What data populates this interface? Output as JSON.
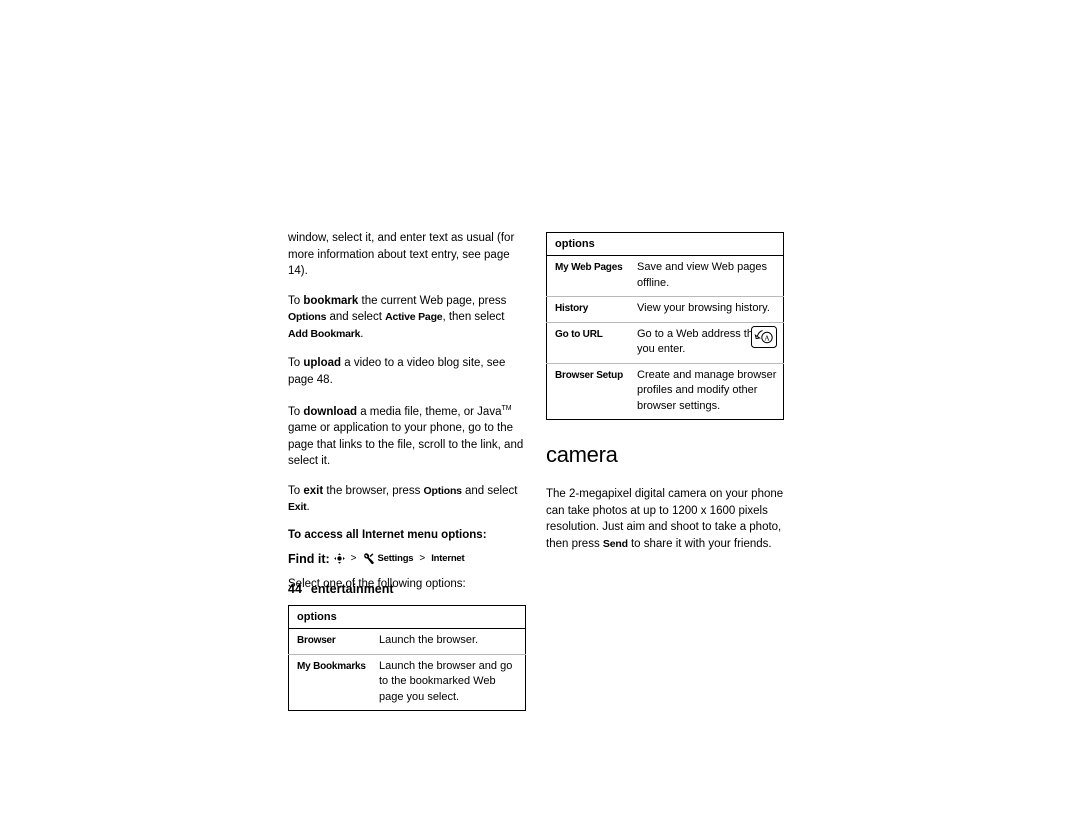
{
  "page": {
    "number": "44",
    "section": "entertainment"
  },
  "left_column": {
    "paragraphs": [
      {
        "id": "p1",
        "runs": [
          {
            "t": "window, select it, and enter text as usual (for more information about text entry, see page 14).",
            "s": "n"
          }
        ]
      },
      {
        "id": "p2",
        "runs": [
          {
            "t": "To ",
            "s": "n"
          },
          {
            "t": "bookmark",
            "s": "b"
          },
          {
            "t": " the current Web page, press ",
            "s": "n"
          },
          {
            "t": "Options",
            "s": "c"
          },
          {
            "t": " and select ",
            "s": "n"
          },
          {
            "t": "Active Page",
            "s": "c"
          },
          {
            "t": ", then select ",
            "s": "n"
          },
          {
            "t": "Add Bookmark",
            "s": "c"
          },
          {
            "t": ".",
            "s": "n"
          }
        ]
      },
      {
        "id": "p3",
        "runs": [
          {
            "t": "To ",
            "s": "n"
          },
          {
            "t": "upload",
            "s": "b"
          },
          {
            "t": " a video to a video blog site, see page 48.",
            "s": "n"
          }
        ]
      },
      {
        "id": "p4",
        "runs": [
          {
            "t": "To ",
            "s": "n"
          },
          {
            "t": "download",
            "s": "b"
          },
          {
            "t": " a media file, theme, or Java",
            "s": "n"
          },
          {
            "t": "TM",
            "s": "sup"
          },
          {
            "t": " game or application to your phone, go to the page that links to the file, scroll to the link, and select it.",
            "s": "n"
          }
        ]
      },
      {
        "id": "p5",
        "runs": [
          {
            "t": "To ",
            "s": "n"
          },
          {
            "t": "exit",
            "s": "b"
          },
          {
            "t": " the browser, press ",
            "s": "n"
          },
          {
            "t": "Options",
            "s": "c"
          },
          {
            "t": " and select ",
            "s": "n"
          },
          {
            "t": "Exit",
            "s": "c"
          },
          {
            "t": ".",
            "s": "n"
          }
        ]
      }
    ],
    "access_heading": "To access all Internet menu options:",
    "find_it": {
      "label": "Find it:",
      "separator": ">",
      "joystick_icon": "joystick-icon",
      "tools_icon": "tools-icon",
      "settings_label": "Settings",
      "internet_label": "Internet"
    },
    "select_line": "Select one of the following options:",
    "table": {
      "header": "options",
      "rows": [
        {
          "key": "Browser",
          "value": "Launch the browser."
        },
        {
          "key": "My Bookmarks",
          "value": "Launch the browser and go to the bookmarked Web page you select."
        }
      ]
    }
  },
  "right_column": {
    "table": {
      "header": "options",
      "rows": [
        {
          "key": "My Web Pages",
          "value": "Save and view Web pages offline.",
          "icon": ""
        },
        {
          "key": "History",
          "value": "View your browsing history.",
          "icon": ""
        },
        {
          "key": "Go to URL",
          "value": "Go to a Web address that you enter.",
          "icon": "url-entry-icon"
        },
        {
          "key": "Browser Setup",
          "value": "Create and manage browser profiles and modify other browser settings.",
          "icon": ""
        }
      ]
    },
    "chapter_title": "camera",
    "paragraph": {
      "runs": [
        {
          "t": "The 2-megapixel digital camera on your phone can take photos at up to 1200 x 1600 pixels resolution. Just aim and shoot to take a photo, then press ",
          "s": "n"
        },
        {
          "t": "Send",
          "s": "c"
        },
        {
          "t": " to share it with your friends.",
          "s": "n"
        }
      ]
    }
  }
}
